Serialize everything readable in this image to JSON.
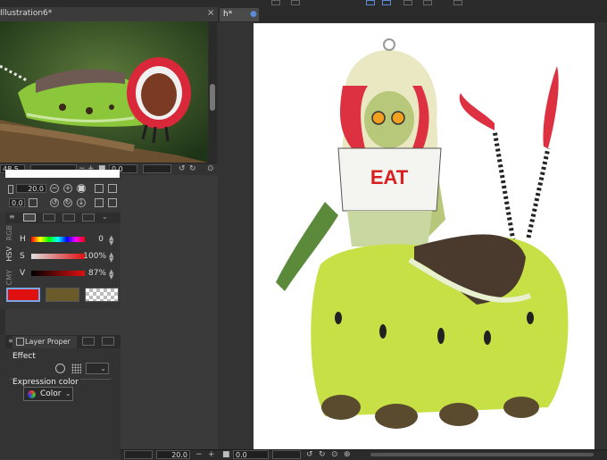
{
  "subview": {
    "tab_label": "Illustration6*",
    "close_glyph": "×",
    "zoom_value": "48.5",
    "rotate_value": "0.0"
  },
  "brush": {
    "size_value": "20.0",
    "opacity_value": "0.0"
  },
  "color": {
    "side_labels": [
      "RGB",
      "HSV",
      "CMY"
    ],
    "h_label": "H",
    "h_value": "0",
    "s_label": "S",
    "s_value": "100%",
    "v_label": "V",
    "v_value": "87%",
    "main_color": "#e01010",
    "sub_color": "#6b5b2a"
  },
  "layer_property": {
    "tab_label": "Layer Proper",
    "effect_label": "Effect",
    "expression_label": "Expression color",
    "expression_value": "Color"
  },
  "document": {
    "tab_label": "h*",
    "close_glyph": "×",
    "artwork_text": "EAT"
  },
  "bottom_bar": {
    "zoom_value": "20.0",
    "rotate_value": "0.0"
  }
}
